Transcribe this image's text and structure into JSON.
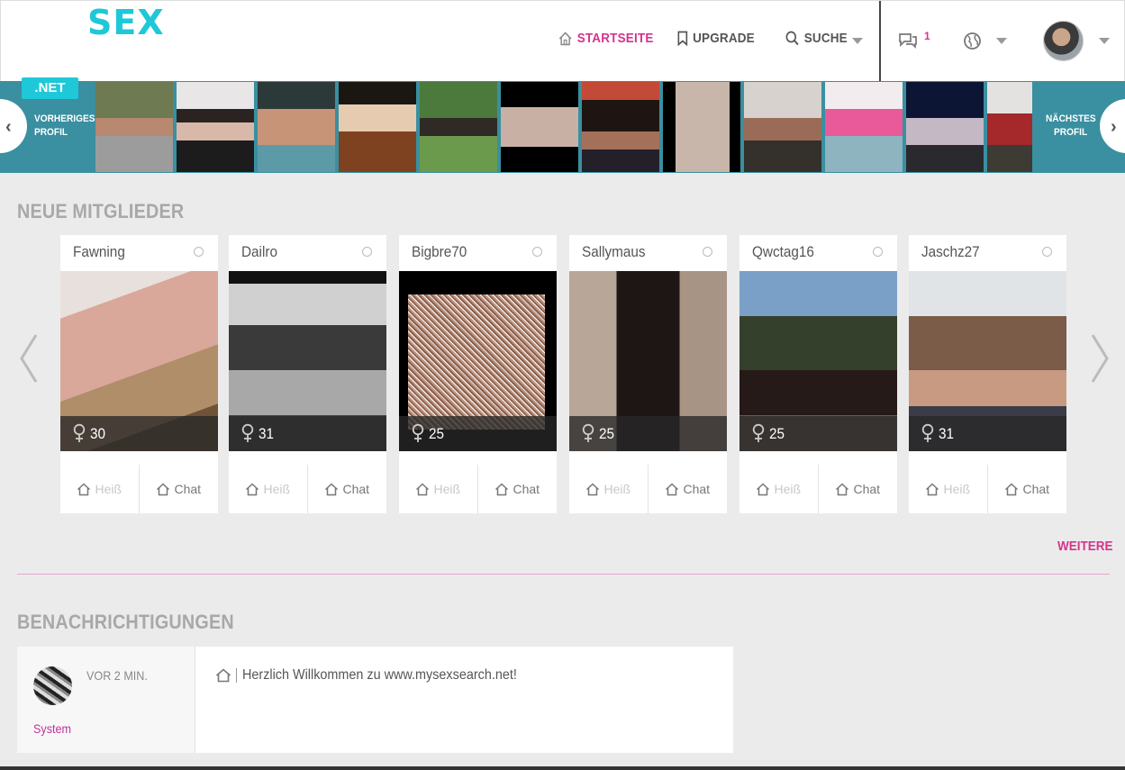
{
  "header": {
    "logo": "SEX",
    "nav": {
      "home": "STARTSEITE",
      "upgrade": "UPGRADE",
      "search": "SUCHE"
    },
    "chat_count": "1",
    "accent_color": "#d6338e",
    "brand_color": "#1ec8d8"
  },
  "strip": {
    "badge": ".NET",
    "prev_label": "VORHERIGES PROFIL",
    "next_label": "NÄCHSTES PROFIL"
  },
  "members": {
    "title": "NEUE MITGLIEDER",
    "cards": [
      {
        "name": "Fawning",
        "age": "30",
        "hot": "Heiß",
        "chat": "Chat"
      },
      {
        "name": "Dailro",
        "age": "31",
        "hot": "Heiß",
        "chat": "Chat"
      },
      {
        "name": "Bigbre70",
        "age": "25",
        "hot": "Heiß",
        "chat": "Chat"
      },
      {
        "name": "Sallymaus",
        "age": "25",
        "hot": "Heiß",
        "chat": "Chat"
      },
      {
        "name": "Qwctag16",
        "age": "25",
        "hot": "Heiß",
        "chat": "Chat"
      },
      {
        "name": "Jaschz27",
        "age": "31",
        "hot": "Heiß",
        "chat": "Chat"
      }
    ],
    "more": "WEITERE"
  },
  "notifications": {
    "title": "BENACHRICHTIGUNGEN",
    "items": [
      {
        "time": "VOR 2 MIN.",
        "sender": "System",
        "message": "Herzlich Willkommen zu www.mysexsearch.net!"
      }
    ]
  }
}
